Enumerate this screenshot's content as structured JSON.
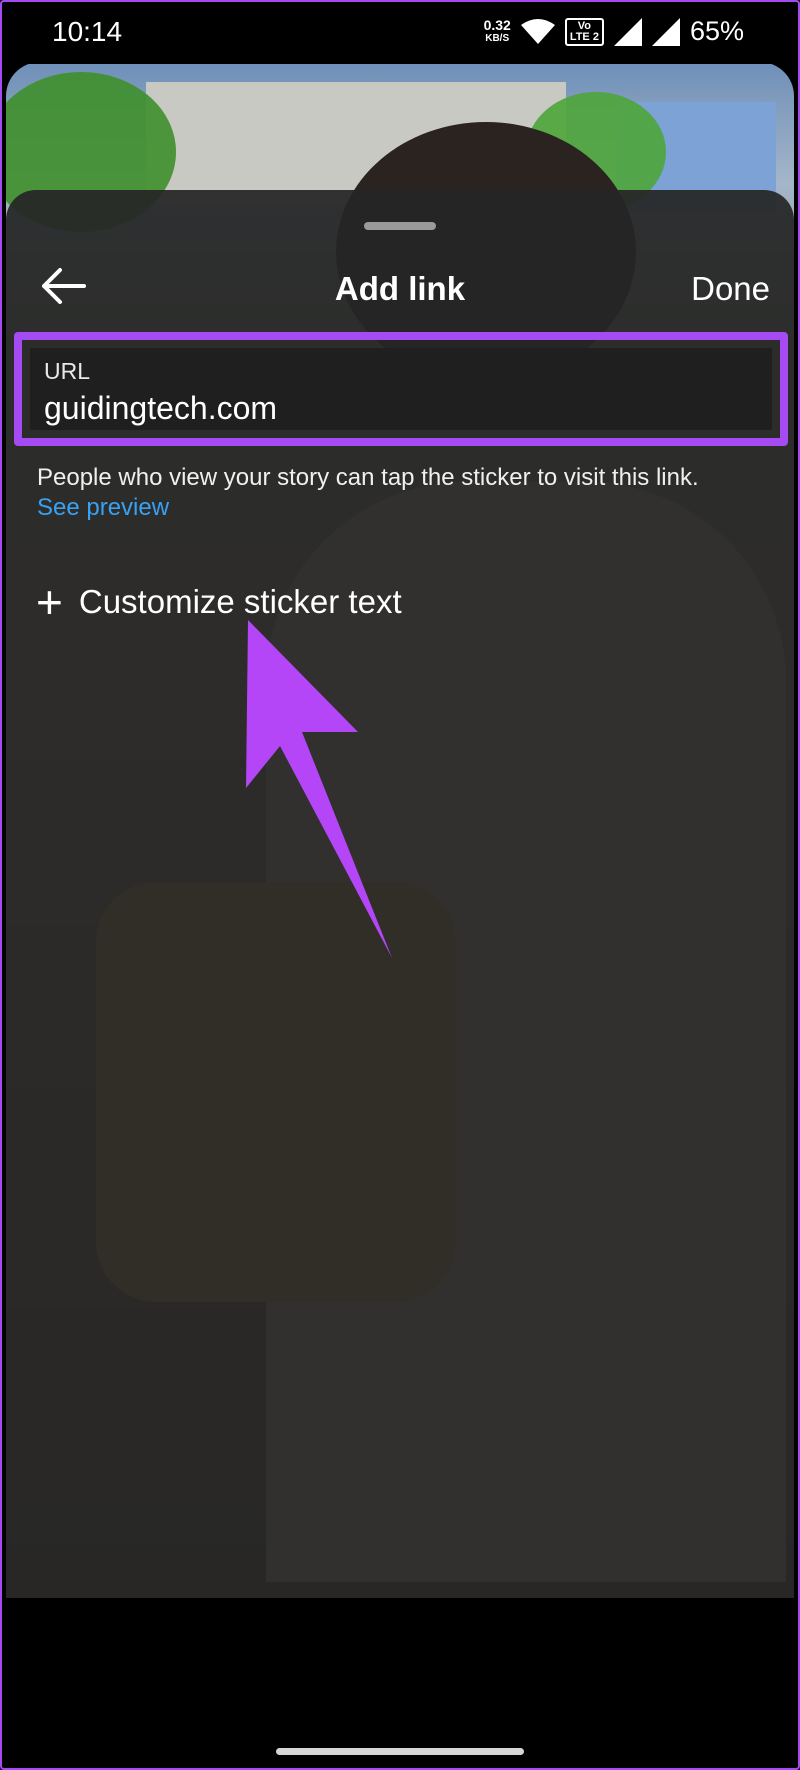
{
  "statusbar": {
    "time": "10:14",
    "net_speed_value": "0.32",
    "net_speed_unit": "KB/S",
    "lte_top": "Vo",
    "lte_bottom": "LTE 2",
    "battery": "65%"
  },
  "sheet": {
    "title": "Add link",
    "done_label": "Done",
    "url_label": "URL",
    "url_value": "guidingtech.com",
    "helper_text": "People who view your story can tap the sticker to visit this link.",
    "preview_link": "See preview",
    "customize_label": "Customize sticker text"
  },
  "colors": {
    "highlight": "#a64bf4",
    "link": "#3aa0f0",
    "sheet_bg": "#262626"
  }
}
